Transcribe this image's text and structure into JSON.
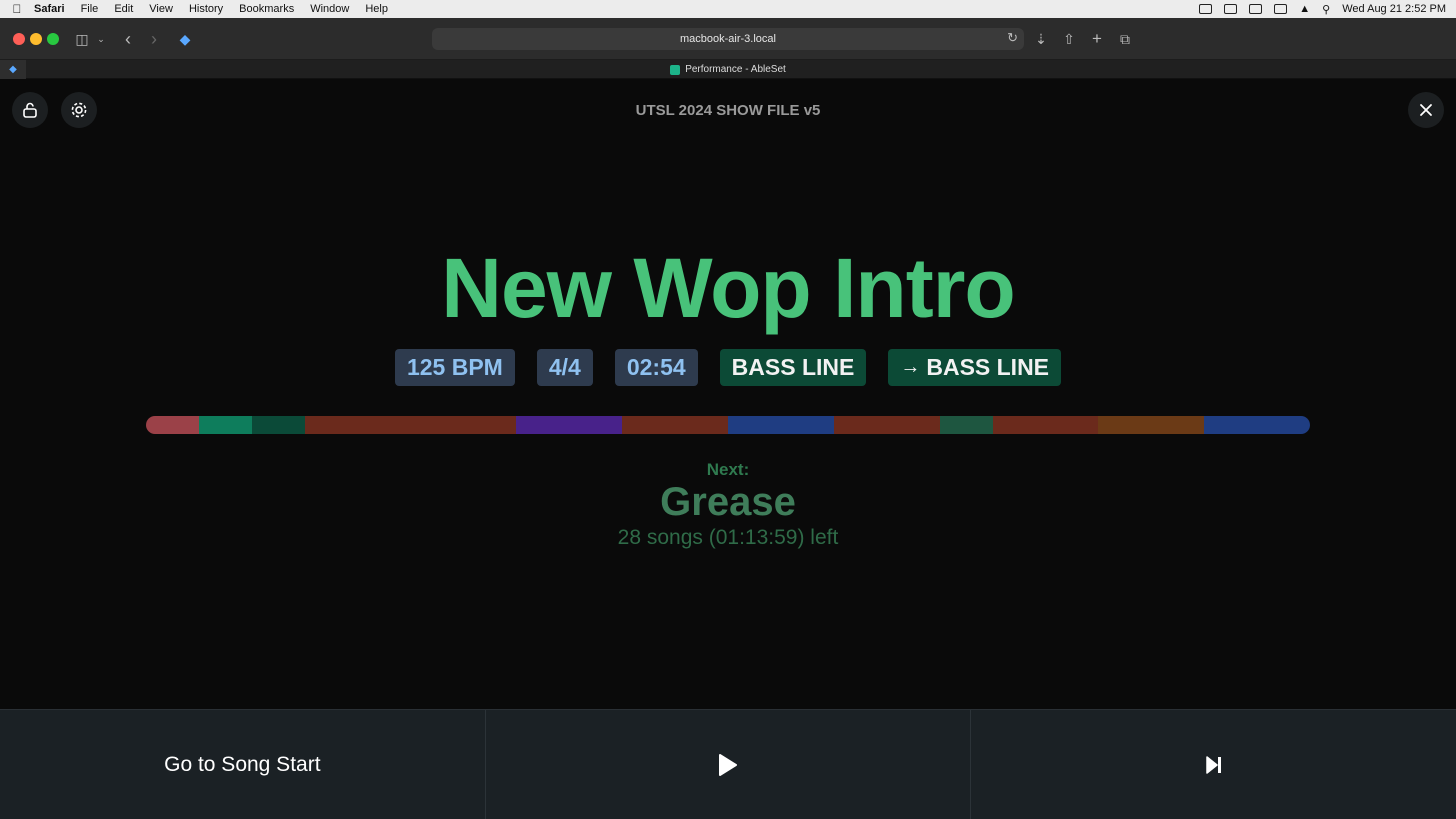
{
  "menubar": {
    "app_name": "Safari",
    "items": [
      "File",
      "Edit",
      "View",
      "History",
      "Bookmarks",
      "Window",
      "Help"
    ],
    "clock": "Wed Aug 21  2:52 PM"
  },
  "browser": {
    "address": "macbook-air-3.local",
    "tab_title": "Performance - AbleSet"
  },
  "app": {
    "show_title": "UTSL 2024 SHOW FILE v5",
    "song_title": "New Wop Intro",
    "badges": {
      "bpm": "125 BPM",
      "time_signature": "4/4",
      "duration": "02:54",
      "current_section": "BASS LINE",
      "next_section": "BASS LINE"
    },
    "timeline_colors": [
      "#9b4148",
      "#0e7d5c",
      "#0b4a38",
      "#6b2a1c",
      "#6b2a1c",
      "#6b2a1c",
      "#6b2a1c",
      "#48228a",
      "#48228a",
      "#6b2a1c",
      "#6b2a1c",
      "#1f3d82",
      "#1f3d82",
      "#6b2a1c",
      "#6b2a1c",
      "#1e5640",
      "#6b2a1c",
      "#6b2a1c",
      "#6b3a16",
      "#6b3a16",
      "#1f3d82",
      "#1f3d82"
    ],
    "next_label": "Next:",
    "next_song": "Grease",
    "remaining": "28 songs (01:13:59) left",
    "controls": {
      "go_to_start": "Go to Song Start"
    },
    "accent_color": "#48c27a"
  }
}
